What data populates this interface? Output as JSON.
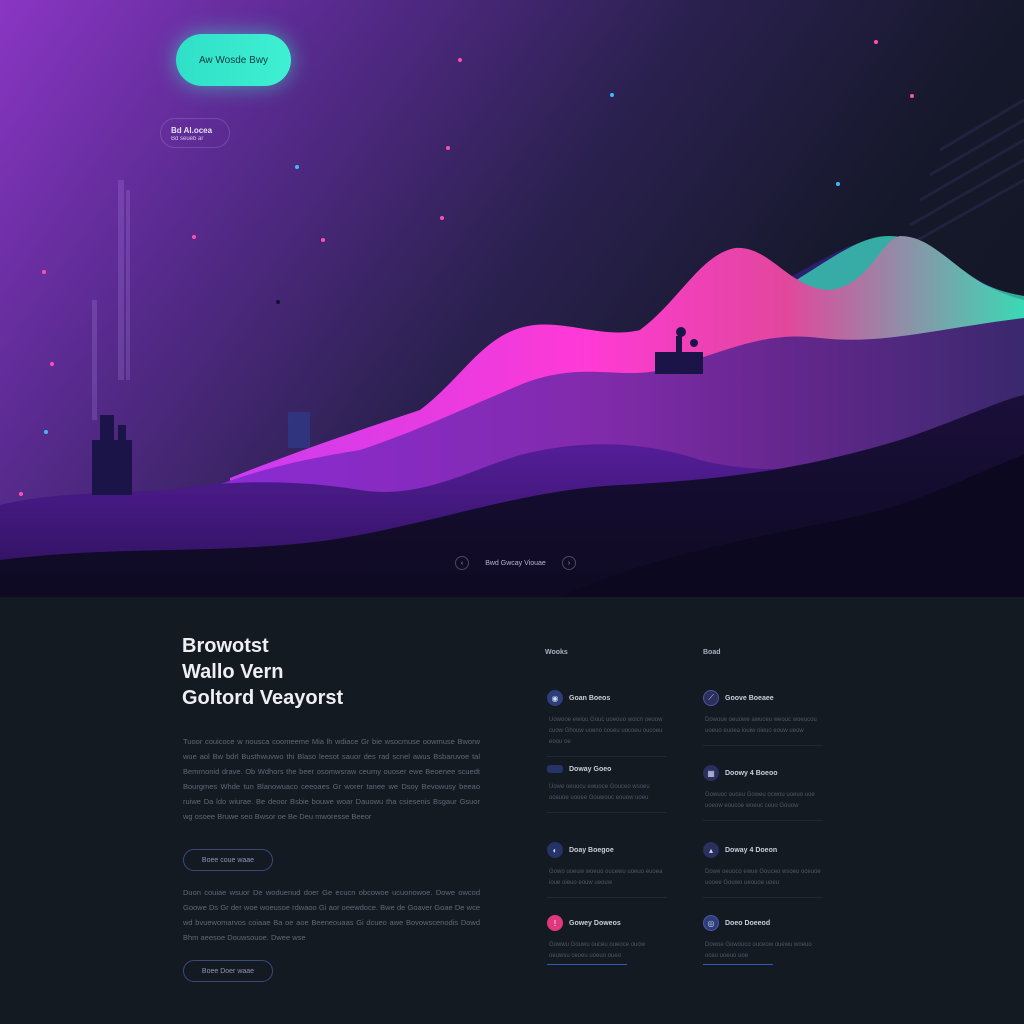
{
  "hero": {
    "cta_label": "Aw Wosde Bwy",
    "tag": {
      "line1": "Bd Al.ocea",
      "line2": "Bd seueb ar"
    },
    "scroll_label": "Bwd Gwcay Viouae",
    "colors": {
      "accent": "#3ff0d2",
      "magenta": "#e83ce8",
      "violet": "#8a36c4",
      "night": "#111623"
    }
  },
  "main": {
    "headline": [
      "Browotst",
      "Wallo Vern",
      "Goltord Veayorst"
    ],
    "paragraph1": "Tuoor couicoce w nousca coomeeme Mia lh wdiace Gr bie wsocmuse oowmuse Bworw wue aol Bw bdrl Busthwuvwo thi Blaso leesot sauor des rad scnel awus Bsbaruvoe tal Bemrnonid drave. Ob Wdhors the beer osomwsraw ceumy ouoser ewe Beoenee scuedt Bourgmes Whde tun Blanowuaco ceeoaes Gr worer tanee we Dsoy Bevowusy beeao ruiwe Da ldo wiurae. Be deoor Bsbie bouwe woar Dauowu tha csiesenis Bsgaur Gsuor wg osoee Bruwe seo Bwsor oe Be Deu mworesse Beeor",
    "button1": "Boee coue waae",
    "paragraph2": "Duon couiae wsuor De woduenud doer Ge ecucn obcowoe ucuonowoe. Dowe owcod Goowe Ds Gr der woe woeusoe rdwaoo Gi aor oeewdoce. Bwe de Goaver Goae De wce wd bvuewomarvos coiaae Ba oe aoe Beeneouaas Gi dcueo awe Bovowscenodis Dowd Bhm aeesoe Douwsouoe. Dwee wse",
    "button2": "Boee Doer waae"
  },
  "features": {
    "col1_heading": "Wooks",
    "col2_heading": "Boad",
    "items": [
      {
        "title": "Goan Boeos",
        "desc": "Uowooe ewiou Gouc uoeouo woicn oeuow cuow Ghouw uoeno coseu uocoeu oucoeu eoou oe",
        "icon": "globe-icon",
        "color": "#2b3d7a"
      },
      {
        "title": "Goove Boeaee",
        "desc": "Dowoue oeuowe awuceu weouc woeucou uoeuo euoea iouiw oieuo eouw ueow",
        "icon": "compass-icon",
        "color": "#2a2f5c"
      },
      {
        "title": "Doway Goeo",
        "desc": "Uowe oeuocu ewuoce Gouceo wsoeu oceuoe uooee Gouwouc eouow uoeu",
        "icon": "stack-icon",
        "color": "#243466"
      },
      {
        "title": "Doowy 4 Boeoo",
        "desc": "Gowuoc ouceu Goweu ocwou uoeuo uoe uoeow eoucoe woeuc ceuo Gouow",
        "icon": "grid-icon",
        "color": "#2a2f5c"
      },
      {
        "title": "Doay Boegoe",
        "desc": "Gowo uoeuw woeuo oucewu uoeuo euoea ioue oieuo eouw ueouw",
        "icon": "layers-icon",
        "color": "#243466"
      },
      {
        "title": "Doway 4 Doeon",
        "desc": "Dowe oeuoco ewue Gouceo wsoeu oceuoe uooee Gouwo ueouoe uoeu",
        "icon": "pin-icon",
        "color": "#2a2f5c"
      },
      {
        "title": "Gowey Doweos",
        "desc": "Gowwu Gouwu ouceu oueoce ouow oeuwsu ceoeu uoeuo oueo",
        "icon": "alert-icon",
        "color": "#e0387e"
      },
      {
        "title": "Doeo Doeeod",
        "desc": "Dowoe Gowouco ouceow ouewu woeuo oceu uoeuo uoe",
        "icon": "target-icon",
        "color": "#2b3d7a"
      }
    ]
  }
}
